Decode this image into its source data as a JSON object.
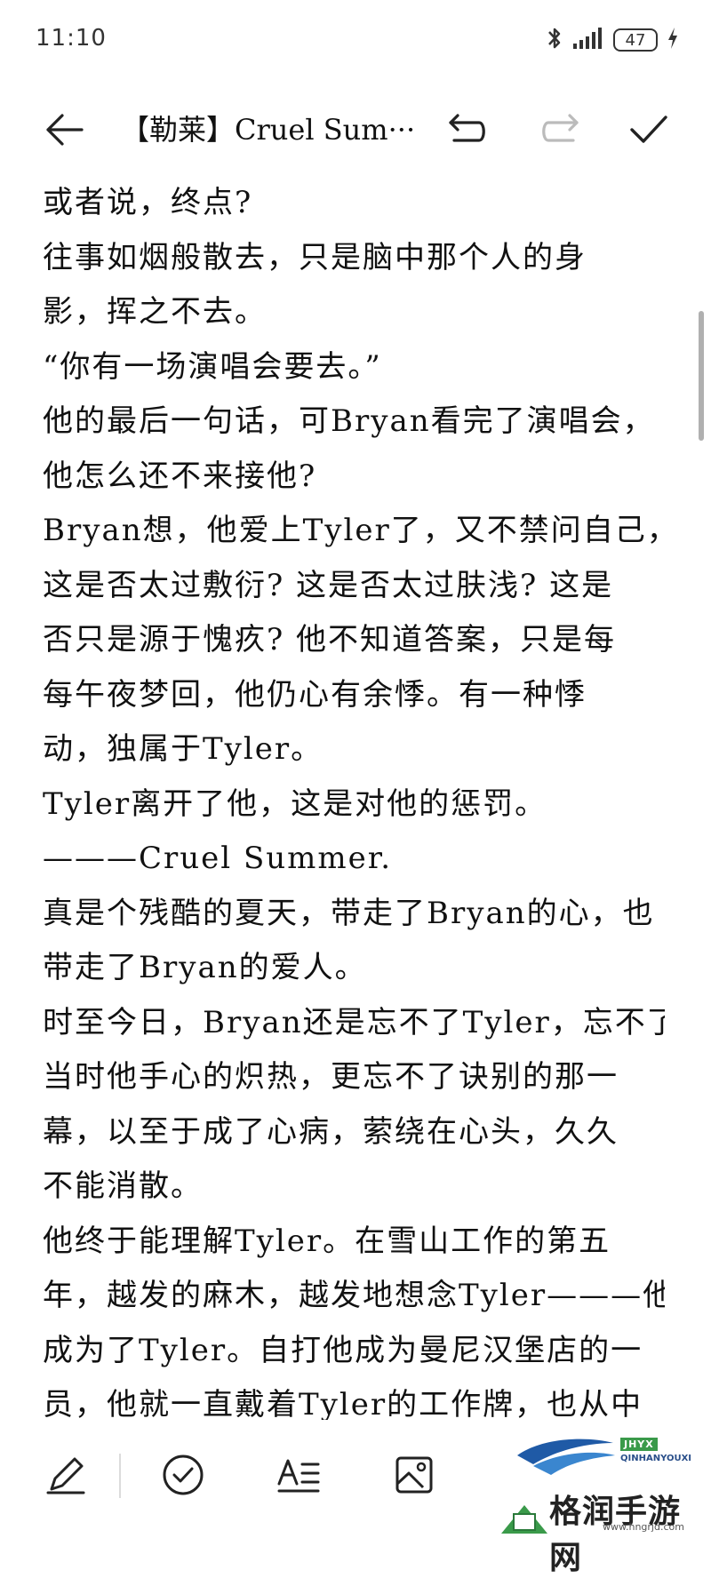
{
  "status_bar": {
    "time": "11:10",
    "battery": "47",
    "icons": [
      "bluetooth-icon",
      "signal-icon",
      "battery-icon",
      "charging-icon"
    ]
  },
  "toolbar": {
    "title": "【勒莱】Cruel Sum···",
    "icons": [
      "back-arrow-icon",
      "undo-icon",
      "redo-icon",
      "check-icon"
    ]
  },
  "content": {
    "paragraphs": [
      "或者说，终点?",
      "往事如烟般散去，只是脑中那个人的身",
      "影，挥之不去。",
      "“你有一场演唱会要去。”",
      "他的最后一句话，可Bryan看完了演唱会，",
      "他怎么还不来接他?",
      "Bryan想，他爱上Tyler了，又不禁问自己，",
      "这是否太过敷衍? 这是否太过肤浅? 这是",
      "否只是源于愧疚? 他不知道答案，只是每",
      "每午夜梦回，他仍心有余悸。有一种悸",
      "动，独属于Tyler。",
      "Tyler离开了他，这是对他的惩罚。",
      "———Cruel Summer.",
      "真是个残酷的夏天，带走了Bryan的心，也",
      "带走了Bryan的爱人。",
      "时至今日，Bryan还是忘不了Tyler，忘不了",
      "当时他手心的炽热，更忘不了诀别的那一",
      "幕，以至于成了心病，萦绕在心头，久久",
      "不能消散。",
      "他终于能理解Tyler。在雪山工作的第五",
      "年，越发的麻木，越发地想念Tyler———他",
      "成为了Tyler。自打他成为曼尼汉堡店的一",
      "员，他就一直戴着Tyler的工作牌，也从中"
    ]
  },
  "bottom_bar": {
    "icons": [
      "pen-icon",
      "checklist-icon",
      "text-format-icon",
      "image-icon"
    ]
  },
  "watermark": {
    "badge": "JHYX",
    "caption": "QINHANYOUXI",
    "title": "格润手游网",
    "url": "www.hngrjd.com"
  },
  "colors": {
    "text": "#111111",
    "background": "#ffffff",
    "icon": "#333333"
  }
}
